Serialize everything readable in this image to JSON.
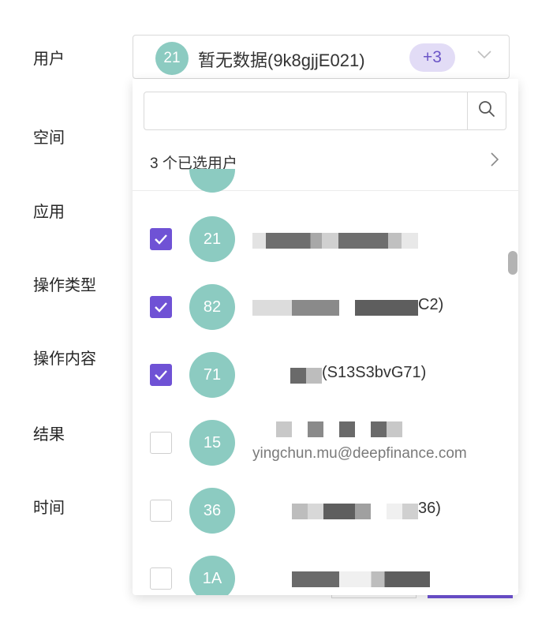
{
  "form": {
    "labels": [
      "用户",
      "空间",
      "应用",
      "操作类型",
      "操作内容",
      "结果",
      "时间"
    ]
  },
  "select": {
    "avatar": "21",
    "name": "暂无数据(9k8gjjE021)",
    "more": "+3",
    "arrow_icon": "chevron-down-icon"
  },
  "dropdown": {
    "search_placeholder": "",
    "search_value": "",
    "selected_count_text": "3 个已选用户",
    "items": [
      {
        "avatar": "21",
        "name": "",
        "email": "",
        "checked": true
      },
      {
        "avatar": "82",
        "name": "C2)",
        "email": "",
        "checked": true
      },
      {
        "avatar": "71",
        "name": "(S13S3bvG71)",
        "email": "",
        "checked": true
      },
      {
        "avatar": "15",
        "name": "",
        "email": "yingchun.mu@deepfinance.com",
        "checked": false
      },
      {
        "avatar": "36",
        "name": "36)",
        "email": "",
        "checked": false
      },
      {
        "avatar": "1A",
        "name": "",
        "email": "",
        "checked": false
      }
    ]
  },
  "colors": {
    "accent": "#6f52d5",
    "avatar_bg": "#8ccbc1",
    "tag_bg": "#e2dcf6",
    "tag_text": "#6b55c7"
  }
}
